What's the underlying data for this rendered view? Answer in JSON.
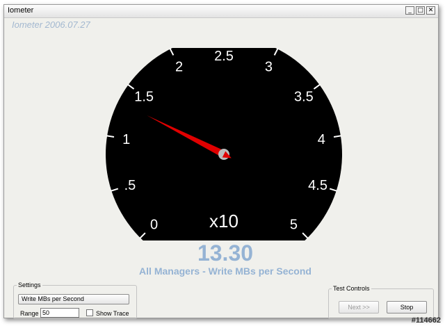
{
  "window": {
    "title": "Iometer"
  },
  "titlebar_buttons": {
    "minimize": "_",
    "maximize": "□",
    "close": "✕"
  },
  "version_label": "Iometer 2006.07.27",
  "gauge": {
    "min": 0,
    "max": 5,
    "labels": [
      "0",
      ".5",
      "1",
      "1.5",
      "2",
      "2.5",
      "3",
      "3.5",
      "4",
      "4.5",
      "5"
    ],
    "multiplier": "x10",
    "needle_value": 1.33,
    "background": "#000000",
    "needle_color": "#e00000",
    "hub_color": "#bbbbbb"
  },
  "readout": {
    "value": "13.30",
    "caption": "All Managers - Write MBs per Second"
  },
  "settings": {
    "legend": "Settings",
    "mode_button": "Write MBs per Second",
    "range_label": "Range",
    "range_value": "50",
    "show_trace_label": "Show Trace",
    "show_trace_checked": false
  },
  "test_controls": {
    "legend": "Test Controls",
    "next_label": "Next >>",
    "stop_label": "Stop"
  },
  "watermark": "#114662",
  "colors": {
    "accent_text": "#95b3d4",
    "version_text": "#a3b8d0"
  }
}
